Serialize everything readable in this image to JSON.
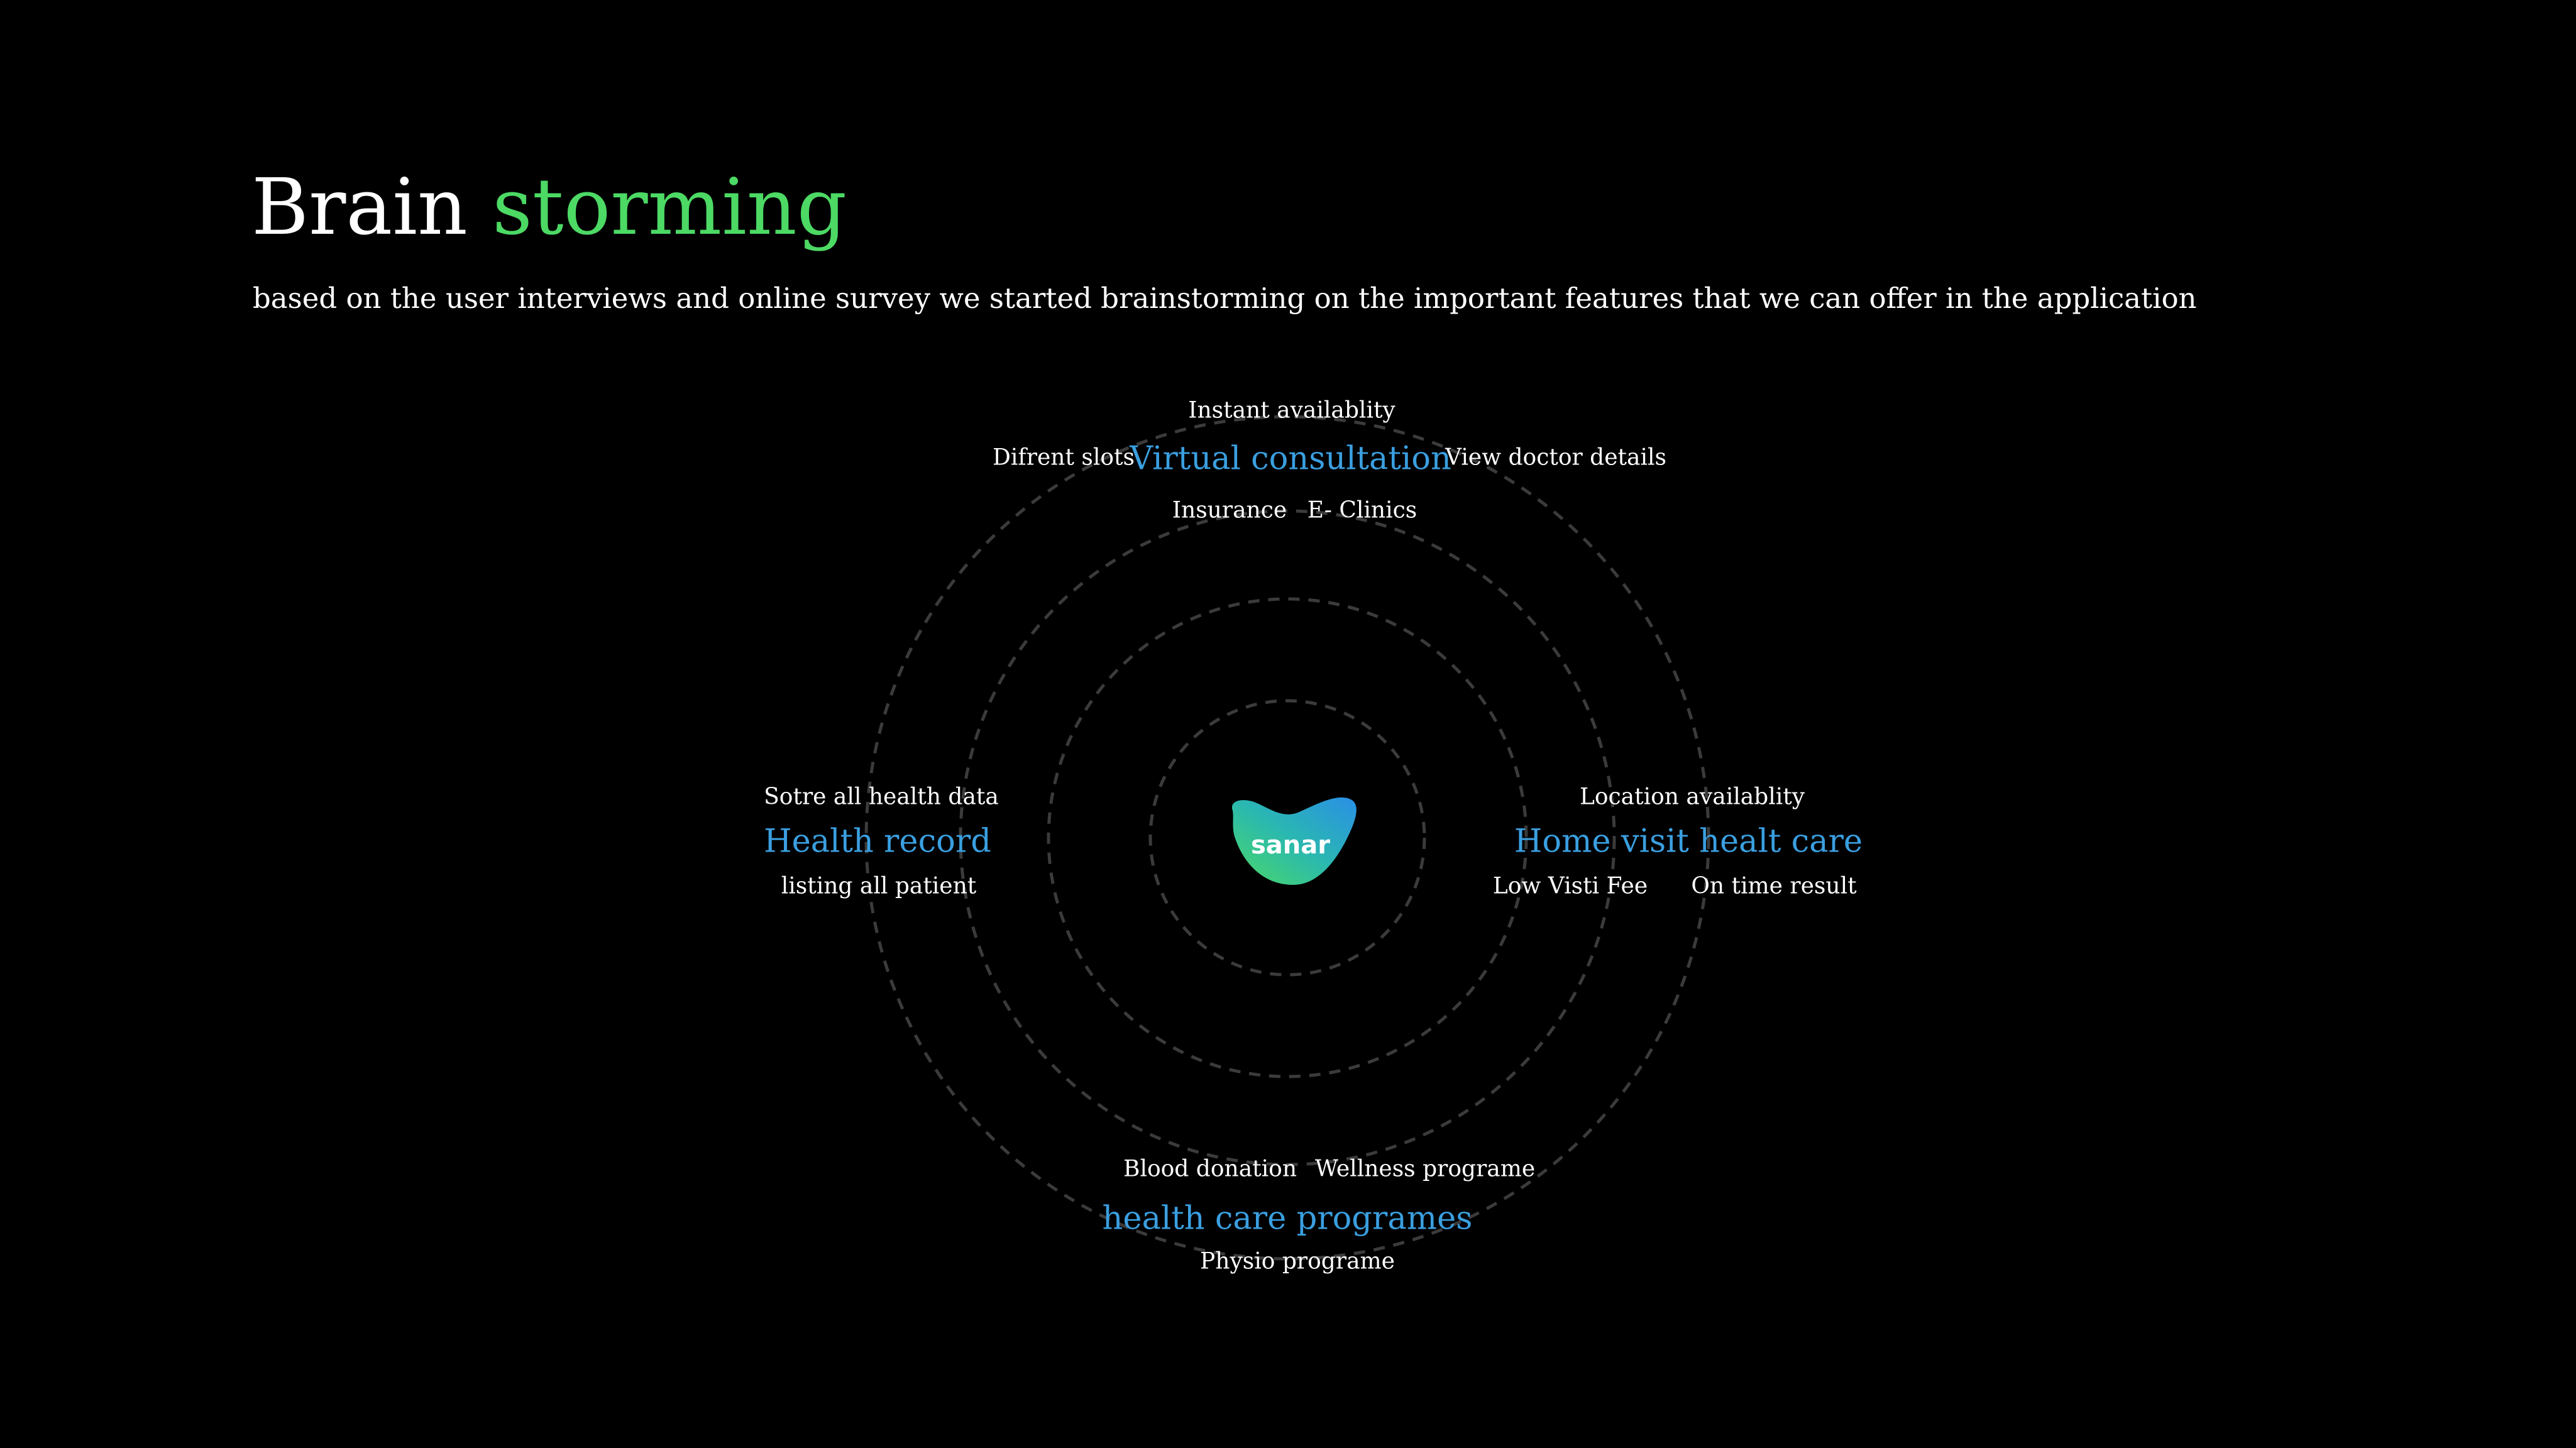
{
  "colors": {
    "background": "#000000",
    "accent_green": "#4cd964",
    "category_blue": "#3a9fe0",
    "ring_stroke": "#3b3b3b"
  },
  "header": {
    "title_plain": "Brain",
    "title_accent": "storming",
    "subtitle": "based on the user interviews and online survey we started brainstorming on the important features that we can offer in the application"
  },
  "logo": {
    "icon": "sanar-logo-icon",
    "text": "sanar"
  },
  "clusters": {
    "virtual": {
      "title": "Virtual consultation",
      "top": "Instant availablity",
      "left": "Difrent slots",
      "right": "View doctor details",
      "bottom_left": "Insurance",
      "bottom_right": "E- Clinics"
    },
    "record": {
      "title": "Health record",
      "top": "Sotre all health data",
      "bottom": "listing all patient"
    },
    "home": {
      "title": "Home visit healt care",
      "top": "Location availablity",
      "bottom_left": "Low Visti Fee",
      "bottom_right": "On time result"
    },
    "programs": {
      "title": "health care programes",
      "top_left": "Blood donation",
      "top_right": "Wellness programe",
      "bottom": "Physio programe"
    }
  }
}
